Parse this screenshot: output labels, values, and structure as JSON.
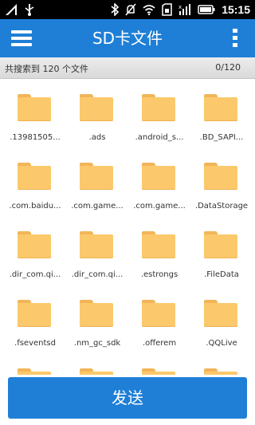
{
  "status_bar": {
    "time": "15:15",
    "icons": [
      "signal-icon",
      "usb-icon",
      "bluetooth-icon",
      "muted-bell-icon",
      "wifi-icon",
      "sd-card-icon",
      "no-signal-icon",
      "battery-icon"
    ]
  },
  "header": {
    "title": "SD卡文件",
    "menu_icon": "hamburger-menu-icon",
    "more_icon": "more-vertical-icon"
  },
  "info": {
    "summary": "共搜索到 120 个文件",
    "selection_count": "0/120"
  },
  "files": [
    {
      "name": ".13981505..."
    },
    {
      "name": ".ads"
    },
    {
      "name": ".android_s..."
    },
    {
      "name": ".BD_SAPI..."
    },
    {
      "name": ".com.baidu..."
    },
    {
      "name": ".com.game..."
    },
    {
      "name": ".com.game..."
    },
    {
      "name": ".DataStorage"
    },
    {
      "name": ".dir_com.qi..."
    },
    {
      "name": ".dir_com.qi..."
    },
    {
      "name": ".estrongs"
    },
    {
      "name": ".FileData"
    },
    {
      "name": ".fseventsd"
    },
    {
      "name": ".nm_gc_sdk"
    },
    {
      "name": ".offerem"
    },
    {
      "name": ".QQLive"
    }
  ],
  "footer": {
    "send_label": "发送"
  },
  "colors": {
    "accent": "#1f7fd6",
    "folder": "#fbc96b"
  }
}
